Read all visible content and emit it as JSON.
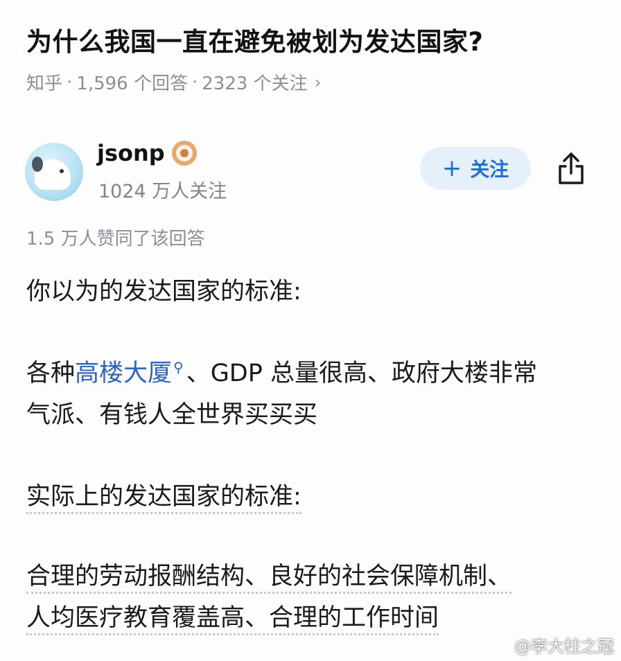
{
  "question": {
    "title": "为什么我国一直在避免被划为发达国家?",
    "source": "知乎",
    "answers": "1,596 个回答",
    "follows": "2323 个关注",
    "chevron": "›"
  },
  "author": {
    "name": "jsonp",
    "followers": "1024 万人关注",
    "follow_plus": "+",
    "follow_label": "关注",
    "avatar_icon": "dog-avatar-icon",
    "badge_icon": "certified-badge-icon",
    "share_icon": "share-icon"
  },
  "answer": {
    "likes": "1.5 万人赞同了该回答",
    "p1": "你以为的发达国家的标准:",
    "p2_pre": "各种",
    "p2_link": "高楼大厦",
    "p2_post": "、GDP 总量很高、政府大楼非常",
    "p2_line2": "气派、有钱人全世界买买买",
    "p3": "实际上的发达国家的标准:",
    "p4_line1": "合理的劳动报酬结构、良好的社会保障机制、",
    "p4_line2": "人均医疗教育覆盖高、合理的工作时间"
  },
  "watermark": {
    "text": "@李大柱之冠",
    "icon": "weibo-icon"
  },
  "colors": {
    "link": "#2b64c8",
    "follow_bg": "#e6f0fb",
    "follow_text": "#1e6fd9",
    "meta_gray": "#8a8f97"
  }
}
